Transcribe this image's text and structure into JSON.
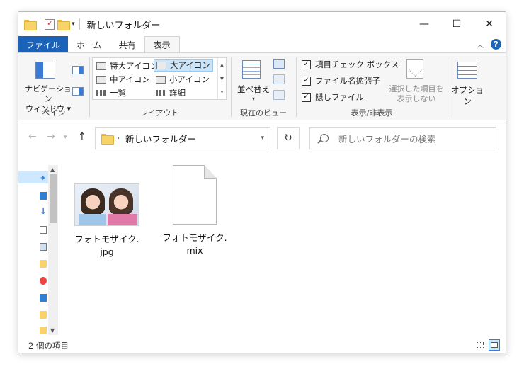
{
  "window": {
    "title": "新しいフォルダー",
    "controls": {
      "minimize": "—",
      "maximize": "☐",
      "close": "✕"
    }
  },
  "ribbon_tabs": [
    {
      "label": "ファイル"
    },
    {
      "label": "ホーム"
    },
    {
      "label": "共有"
    },
    {
      "label": "表示"
    }
  ],
  "ribbon": {
    "pane": {
      "nav_pane_label": "ナビゲーション\nウィンドウ ▾",
      "group_label": "ペイン"
    },
    "layout": {
      "items": [
        "特大アイコン",
        "大アイコン",
        "中アイコン",
        "小アイコン",
        "一覧",
        "詳細"
      ],
      "selected": "大アイコン",
      "group_label": "レイアウト"
    },
    "current_view": {
      "sort_label": "並べ替え",
      "group_label": "現在のビュー"
    },
    "show_hide": {
      "checkboxes": [
        {
          "label": "項目チェック ボックス",
          "checked": true
        },
        {
          "label": "ファイル名拡張子",
          "checked": true
        },
        {
          "label": "隠しファイル",
          "checked": true
        }
      ],
      "hide_selected_label": "選択した項目を\n表示しない",
      "group_label": "表示/非表示"
    },
    "options_label": "オプション"
  },
  "address": {
    "path": "新しいフォルダー"
  },
  "search": {
    "placeholder": "新しいフォルダーの検索"
  },
  "files": [
    {
      "name": "フォトモザイク.\njpg",
      "kind": "image"
    },
    {
      "name": "フォトモザイク.\nmix",
      "kind": "document"
    }
  ],
  "status": {
    "item_count": "2 個の項目"
  },
  "colors": {
    "file_tab": "#1a63b8",
    "selection": "#cce4f7",
    "folder": "#f7d36a"
  }
}
